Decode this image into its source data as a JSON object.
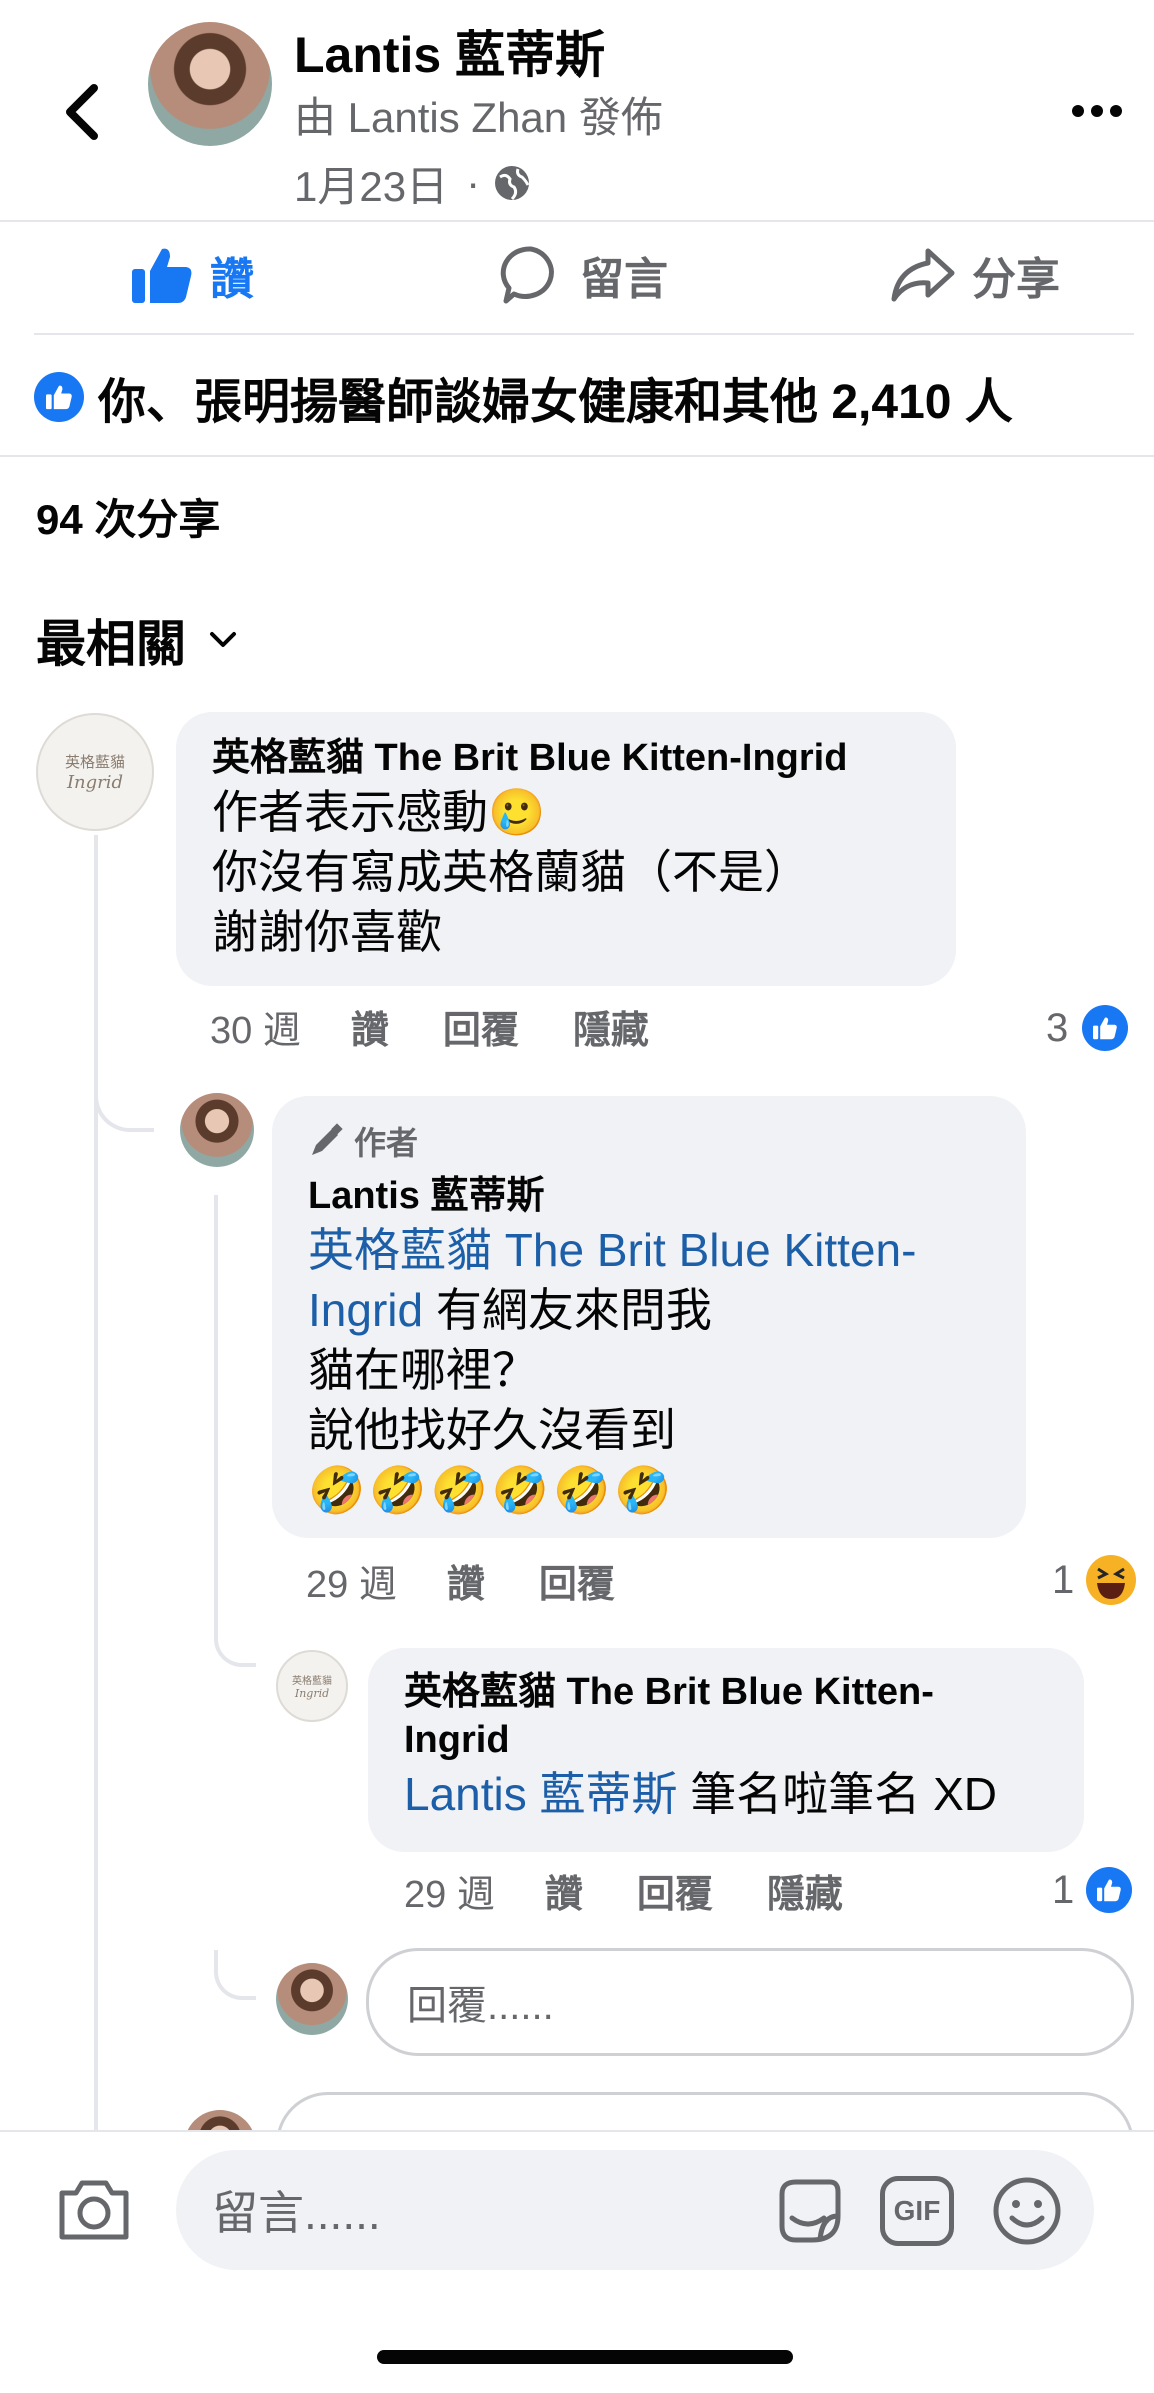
{
  "header": {
    "author_name": "Lantis 藍蒂斯",
    "posted_by": "由 Lantis Zhan 發佈",
    "date": "1月23日",
    "separator": "·"
  },
  "actions": {
    "like": "讚",
    "comment": "留言",
    "share": "分享"
  },
  "reactions_summary": "你、張明揚醫師談婦女健康和其他 2,410 人",
  "shares_count": "94 次分享",
  "sort": {
    "label": "最相關"
  },
  "comments": [
    {
      "name": "英格藍貓 The Brit Blue Kitten-Ingrid",
      "lines": [
        "作者表示感動🥲",
        "你沒有寫成英格蘭貓（不是）",
        "謝謝你喜歡"
      ],
      "time": "30 週",
      "like": "讚",
      "reply": "回覆",
      "hide": "隱藏",
      "reaction_count": "3",
      "avatar_text": "英格藍貓",
      "avatar_sub": "Ingrid"
    },
    {
      "author_badge": "作者",
      "name": "Lantis 藍蒂斯",
      "mention": "英格藍貓 The Brit Blue Kitten-",
      "mention_cont": "Ingrid",
      "line1_rest": " 有網友來問我",
      "lines": [
        "貓在哪裡？",
        "說他找好久沒看到",
        "🤣🤣🤣🤣🤣🤣"
      ],
      "time": "29 週",
      "like": "讚",
      "reply": "回覆",
      "reaction_count": "1"
    },
    {
      "name_line1": "英格藍貓 The Brit Blue Kitten-",
      "name_line2": "Ingrid",
      "mention": "Lantis 藍蒂斯",
      "text": " 筆名啦筆名 XD",
      "time": "29 週",
      "like": "讚",
      "reply": "回覆",
      "hide": "隱藏",
      "reaction_count": "1",
      "avatar_text": "英格藍貓",
      "avatar_sub": "Ingrid"
    }
  ],
  "reply_placeholder": "回覆......",
  "comment_box": {
    "placeholder": "留言......",
    "gif": "GIF"
  },
  "colors": {
    "accent": "#1877f2",
    "mention": "#1c5fa8",
    "bubble": "#f0f2f5",
    "muted": "#65676b"
  }
}
